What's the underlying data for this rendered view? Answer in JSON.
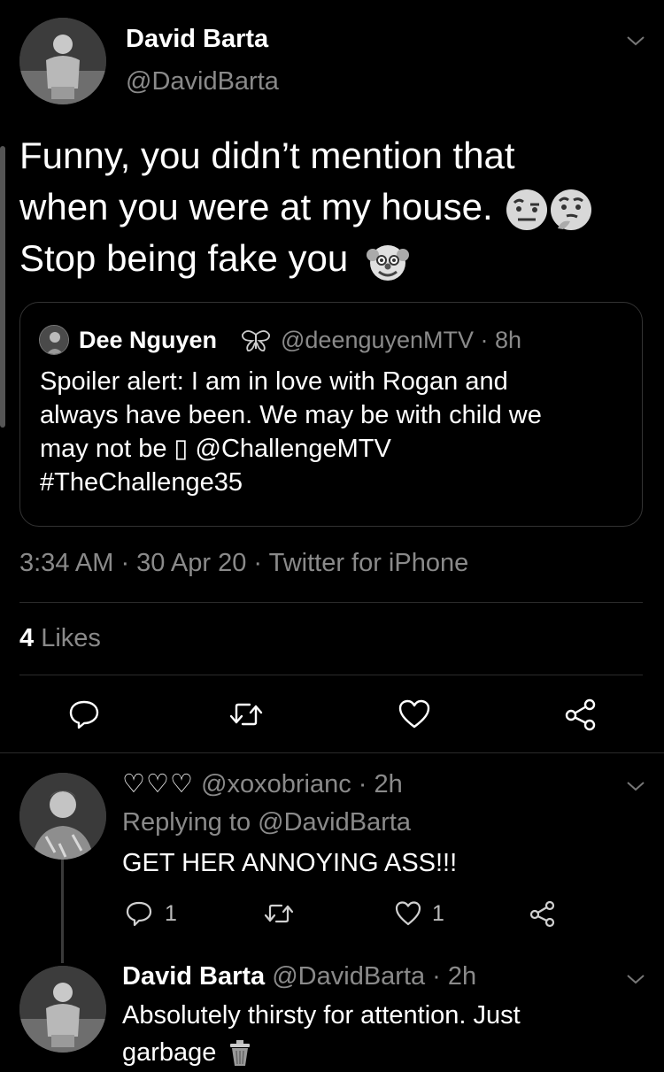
{
  "main_tweet": {
    "author_name": "David Barta",
    "author_handle": "@DavidBarta",
    "text_line1": "Funny, you didn’t mention that",
    "text_line2": "when you were at my house.",
    "text_line3": "Stop being fake you",
    "timestamp": "3:34 AM · 30 Apr 20 · Twitter for iPhone",
    "likes_count": "4",
    "likes_label": "Likes"
  },
  "quoted_tweet": {
    "author_name": "Dee Nguyen",
    "meta": "@deenguyenMTV · 8h",
    "line1": "Spoiler alert: I am in love with Rogan and",
    "line2": "always have been. We may be with child we",
    "line3": "may not be ▯ @ChallengeMTV",
    "line4": "#TheChallenge35"
  },
  "reply1": {
    "author_name": "♡♡♡",
    "meta": "@xoxobrianc · 2h",
    "replying_prefix": "Replying to ",
    "replying_handle": "@DavidBarta",
    "text": "GET HER ANNOYING ASS!!!",
    "reply_count": "1",
    "like_count": "1"
  },
  "reply2": {
    "author_name": "David Barta",
    "meta": "@DavidBarta · 2h",
    "line1": "Absolutely thirsty for attention. Just",
    "line2": "garbage"
  },
  "icons": {
    "reply": "reply-icon",
    "retweet": "retweet-icon",
    "like": "heart-icon",
    "share": "share-icon",
    "more": "chevron-down-icon"
  }
}
